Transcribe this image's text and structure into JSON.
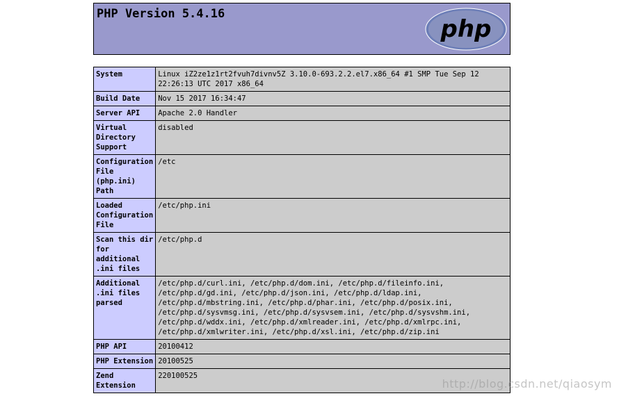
{
  "header": {
    "title": "PHP Version 5.4.16",
    "logo_text": "php"
  },
  "rows": [
    {
      "key": "System",
      "value": "Linux iZ2ze1z1rt2fvuh7divnv5Z 3.10.0-693.2.2.el7.x86_64 #1 SMP Tue Sep 12 22:26:13 UTC 2017 x86_64"
    },
    {
      "key": "Build Date",
      "value": "Nov 15 2017 16:34:47"
    },
    {
      "key": "Server API",
      "value": "Apache 2.0 Handler"
    },
    {
      "key": "Virtual Directory Support",
      "value": "disabled"
    },
    {
      "key": "Configuration File (php.ini) Path",
      "value": "/etc"
    },
    {
      "key": "Loaded Configuration File",
      "value": "/etc/php.ini"
    },
    {
      "key": "Scan this dir for additional .ini files",
      "value": "/etc/php.d"
    },
    {
      "key": "Additional .ini files parsed",
      "value": "/etc/php.d/curl.ini, /etc/php.d/dom.ini, /etc/php.d/fileinfo.ini, /etc/php.d/gd.ini, /etc/php.d/json.ini, /etc/php.d/ldap.ini, /etc/php.d/mbstring.ini, /etc/php.d/phar.ini, /etc/php.d/posix.ini, /etc/php.d/sysvmsg.ini, /etc/php.d/sysvsem.ini, /etc/php.d/sysvshm.ini, /etc/php.d/wddx.ini, /etc/php.d/xmlreader.ini, /etc/php.d/xmlrpc.ini, /etc/php.d/xmlwriter.ini, /etc/php.d/xsl.ini, /etc/php.d/zip.ini"
    },
    {
      "key": "PHP API",
      "value": "20100412"
    },
    {
      "key": "PHP Extension",
      "value": "20100525"
    },
    {
      "key": "Zend Extension",
      "value": "220100525"
    }
  ],
  "watermark": "http://blog.csdn.net/qiaosym"
}
